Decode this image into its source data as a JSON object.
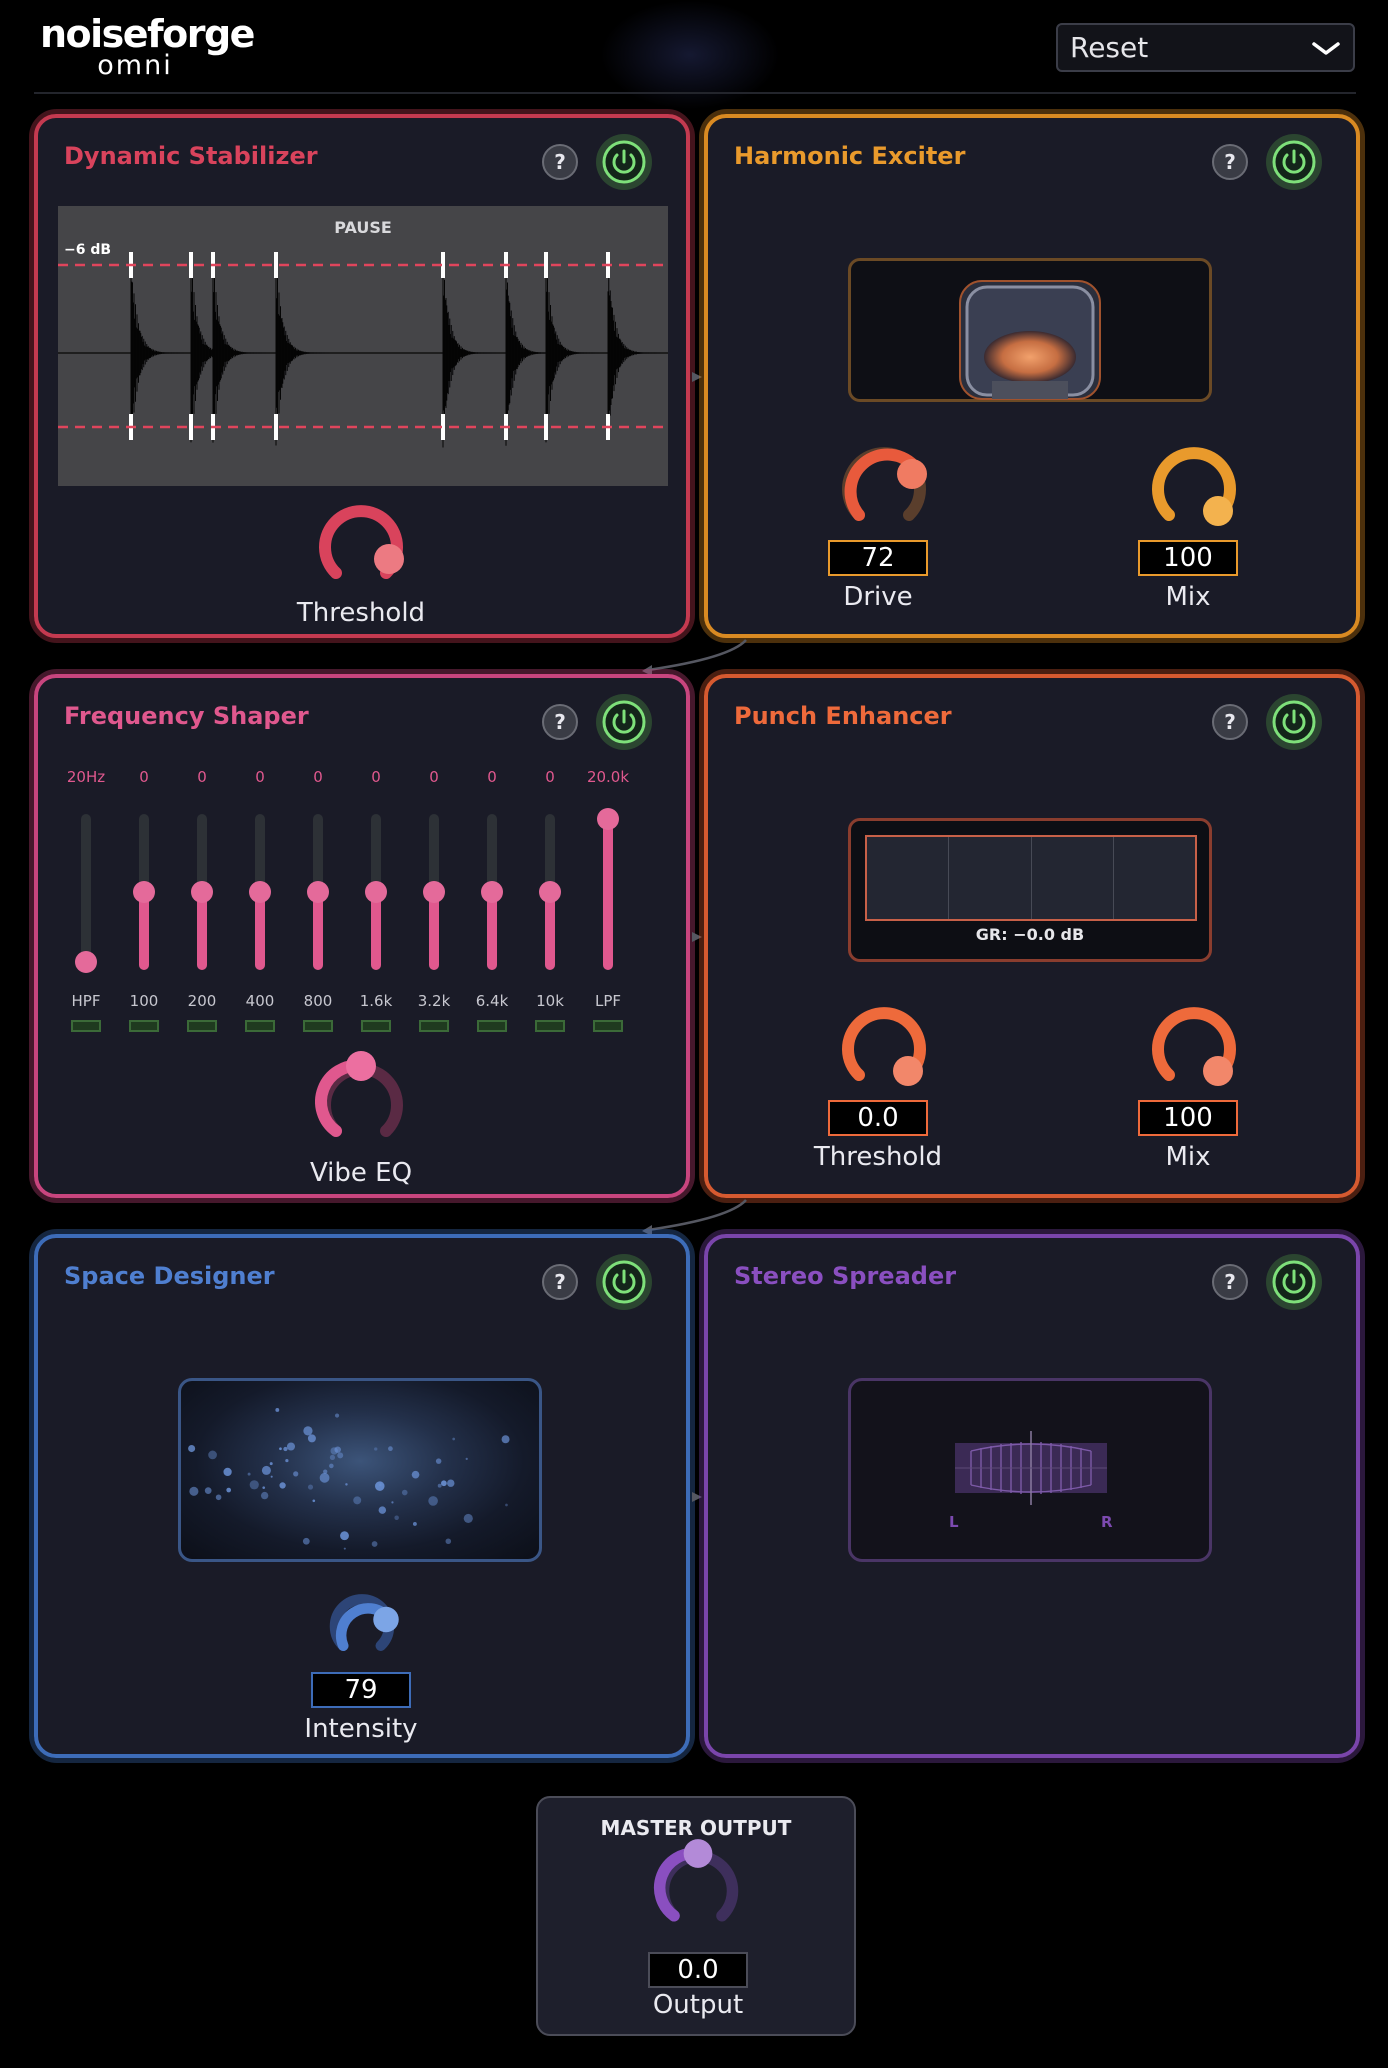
{
  "app": {
    "logo_line1": "noiseforge",
    "logo_line2": "omni"
  },
  "preset": {
    "value": "Reset"
  },
  "modules": {
    "dynamic_stabilizer": {
      "title": "Dynamic Stabilizer",
      "help": "?",
      "color": "#d9435c",
      "waveform": {
        "status": "PAUSE",
        "threshold_label": "−6 dB"
      },
      "threshold": {
        "label": "Threshold"
      }
    },
    "harmonic_exciter": {
      "title": "Harmonic Exciter",
      "help": "?",
      "color": "#e99a2c",
      "drive": {
        "label": "Drive",
        "value": "72"
      },
      "mix": {
        "label": "Mix",
        "value": "100"
      }
    },
    "frequency_shaper": {
      "title": "Frequency Shaper",
      "help": "?",
      "color": "#e0588e",
      "bands": [
        {
          "top": "20Hz",
          "bottom": "HPF",
          "level": 0.05
        },
        {
          "top": "0",
          "bottom": "100",
          "level": 0.5
        },
        {
          "top": "0",
          "bottom": "200",
          "level": 0.5
        },
        {
          "top": "0",
          "bottom": "400",
          "level": 0.5
        },
        {
          "top": "0",
          "bottom": "800",
          "level": 0.5
        },
        {
          "top": "0",
          "bottom": "1.6k",
          "level": 0.5
        },
        {
          "top": "0",
          "bottom": "3.2k",
          "level": 0.5
        },
        {
          "top": "0",
          "bottom": "6.4k",
          "level": 0.5
        },
        {
          "top": "0",
          "bottom": "10k",
          "level": 0.5
        },
        {
          "top": "20.0k",
          "bottom": "LPF",
          "level": 0.97
        }
      ],
      "vibe": {
        "label": "Vibe EQ"
      }
    },
    "punch_enhancer": {
      "title": "Punch Enhancer",
      "help": "?",
      "color": "#ee6a3b",
      "meter": {
        "text": "GR: −0.0 dB"
      },
      "threshold": {
        "label": "Threshold",
        "value": "0.0"
      },
      "mix": {
        "label": "Mix",
        "value": "100"
      }
    },
    "space_designer": {
      "title": "Space Designer",
      "help": "?",
      "color": "#4f7fd0",
      "intensity": {
        "label": "Intensity",
        "value": "79"
      }
    },
    "stereo_spreader": {
      "title": "Stereo Spreader",
      "help": "?",
      "color": "#8a4fc0",
      "left_label": "L",
      "right_label": "R"
    }
  },
  "master": {
    "title": "MASTER OUTPUT",
    "label": "Output",
    "value": "0.0"
  }
}
